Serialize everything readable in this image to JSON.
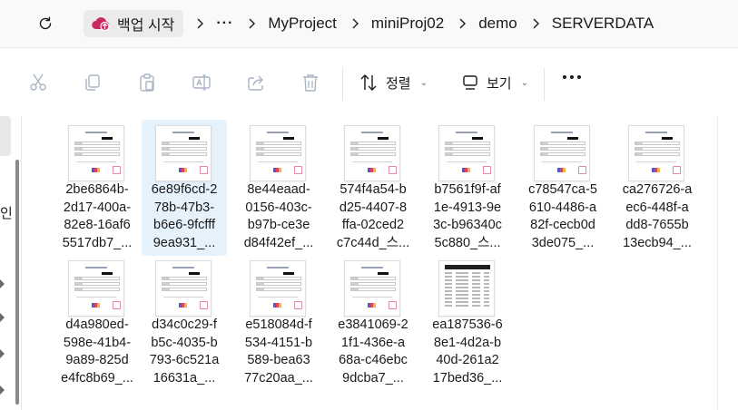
{
  "address": {
    "backup_label": "백업 시작",
    "crumbs": [
      "MyProject",
      "miniProj02",
      "demo",
      "SERVERDATA"
    ]
  },
  "toolbar": {
    "sort_label": "정렬",
    "view_label": "보기"
  },
  "nav": {
    "partial_label": "인"
  },
  "files": [
    {
      "lines": [
        "2be6864b-",
        "2d17-400a-",
        "82e8-16af6",
        "5517db7_..."
      ],
      "kind": "doc"
    },
    {
      "lines": [
        "6e89f6cd-2",
        "78b-47b3-",
        "b6e6-9fcfff",
        "9ea931_..."
      ],
      "kind": "doc",
      "selected": true
    },
    {
      "lines": [
        "8e44eaad-",
        "0156-403c-",
        "b97b-ce3e",
        "d84f42ef_..."
      ],
      "kind": "doc"
    },
    {
      "lines": [
        "574f4a54-b",
        "d25-4407-8",
        "ffa-02ced2",
        "c7c44d_스..."
      ],
      "kind": "doc"
    },
    {
      "lines": [
        "b7561f9f-af",
        "1e-4913-9e",
        "3c-b96340c",
        "5c880_스..."
      ],
      "kind": "doc"
    },
    {
      "lines": [
        "c78547ca-5",
        "610-4486-a",
        "82f-cecb0d",
        "3de075_..."
      ],
      "kind": "doc"
    },
    {
      "lines": [
        "ca276726-a",
        "ec6-448f-a",
        "dd8-7655b",
        "13ecb94_..."
      ],
      "kind": "doc"
    },
    {
      "lines": [
        "d4a980ed-",
        "598e-41b4-",
        "9a89-825d",
        "e4fc8b69_..."
      ],
      "kind": "doc"
    },
    {
      "lines": [
        "d34c0c29-f",
        "b5c-4035-b",
        "793-6c521a",
        "16631a_..."
      ],
      "kind": "doc"
    },
    {
      "lines": [
        "e518084d-f",
        "534-4151-b",
        "589-bea63",
        "77c20aa_..."
      ],
      "kind": "doc"
    },
    {
      "lines": [
        "e3841069-2",
        "1f1-436e-a",
        "68a-c46ebc",
        "9dcba7_..."
      ],
      "kind": "doc"
    },
    {
      "lines": [
        "ea187536-6",
        "8e1-4d2a-b",
        "40d-261a2",
        "17bed36_..."
      ],
      "kind": "sheet"
    }
  ],
  "colors": {
    "selection": "#e5f1fb",
    "backup_icon": "#c72a5c",
    "toolbar_disabled": "#a8b4c4"
  }
}
